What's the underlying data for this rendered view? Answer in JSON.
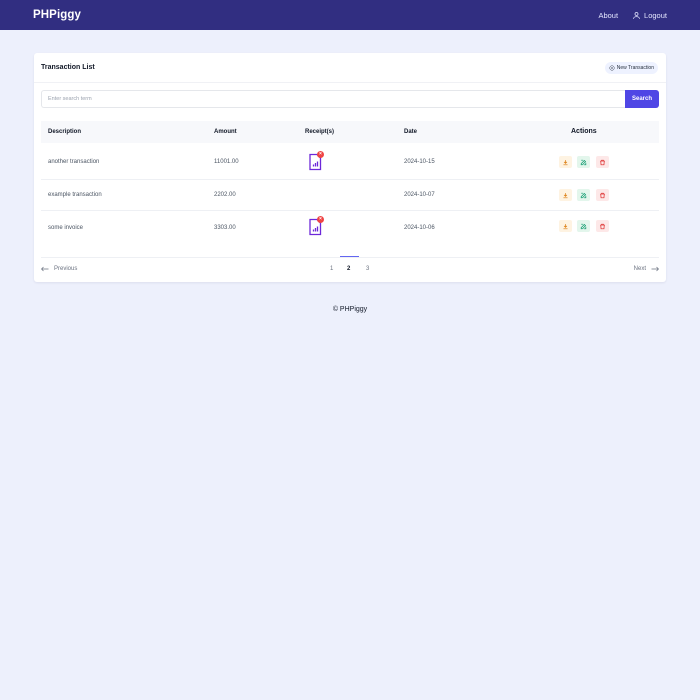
{
  "header": {
    "brand": "PHPiggy",
    "nav": {
      "about": "About",
      "logout": "Logout"
    },
    "color": "#312e81"
  },
  "card": {
    "title": "Transaction List",
    "new_button": "New Transaction"
  },
  "search": {
    "placeholder": "Enter search term",
    "button": "Search"
  },
  "table": {
    "headers": {
      "description": "Description",
      "amount": "Amount",
      "receipts": "Receipt(s)",
      "date": "Date",
      "actions": "Actions"
    },
    "rows": [
      {
        "description": "another transaction",
        "amount": "11001.00",
        "has_receipt": true,
        "date": "2024-10-15"
      },
      {
        "description": "example transaction",
        "amount": "2202.00",
        "has_receipt": false,
        "date": "2024-10-07"
      },
      {
        "description": "some invoice",
        "amount": "3303.00",
        "has_receipt": true,
        "date": "2024-10-06"
      }
    ]
  },
  "pagination": {
    "previous": "Previous",
    "next": "Next",
    "pages": [
      "1",
      "2",
      "3"
    ],
    "current": "2"
  },
  "footer": {
    "text": "© PHPiggy"
  },
  "colors": {
    "accent": "#4f46e5",
    "background": "#edf0fc",
    "danger": "#ef4444"
  },
  "icons": {
    "logout": "user-icon",
    "new_transaction": "plus-circle-icon",
    "receipt": "document-chart-icon",
    "receipt_delete": "close-badge-icon",
    "download": "download-icon",
    "edit": "edit-icon",
    "delete": "trash-icon",
    "prev": "arrow-left-icon",
    "next": "arrow-right-icon"
  }
}
